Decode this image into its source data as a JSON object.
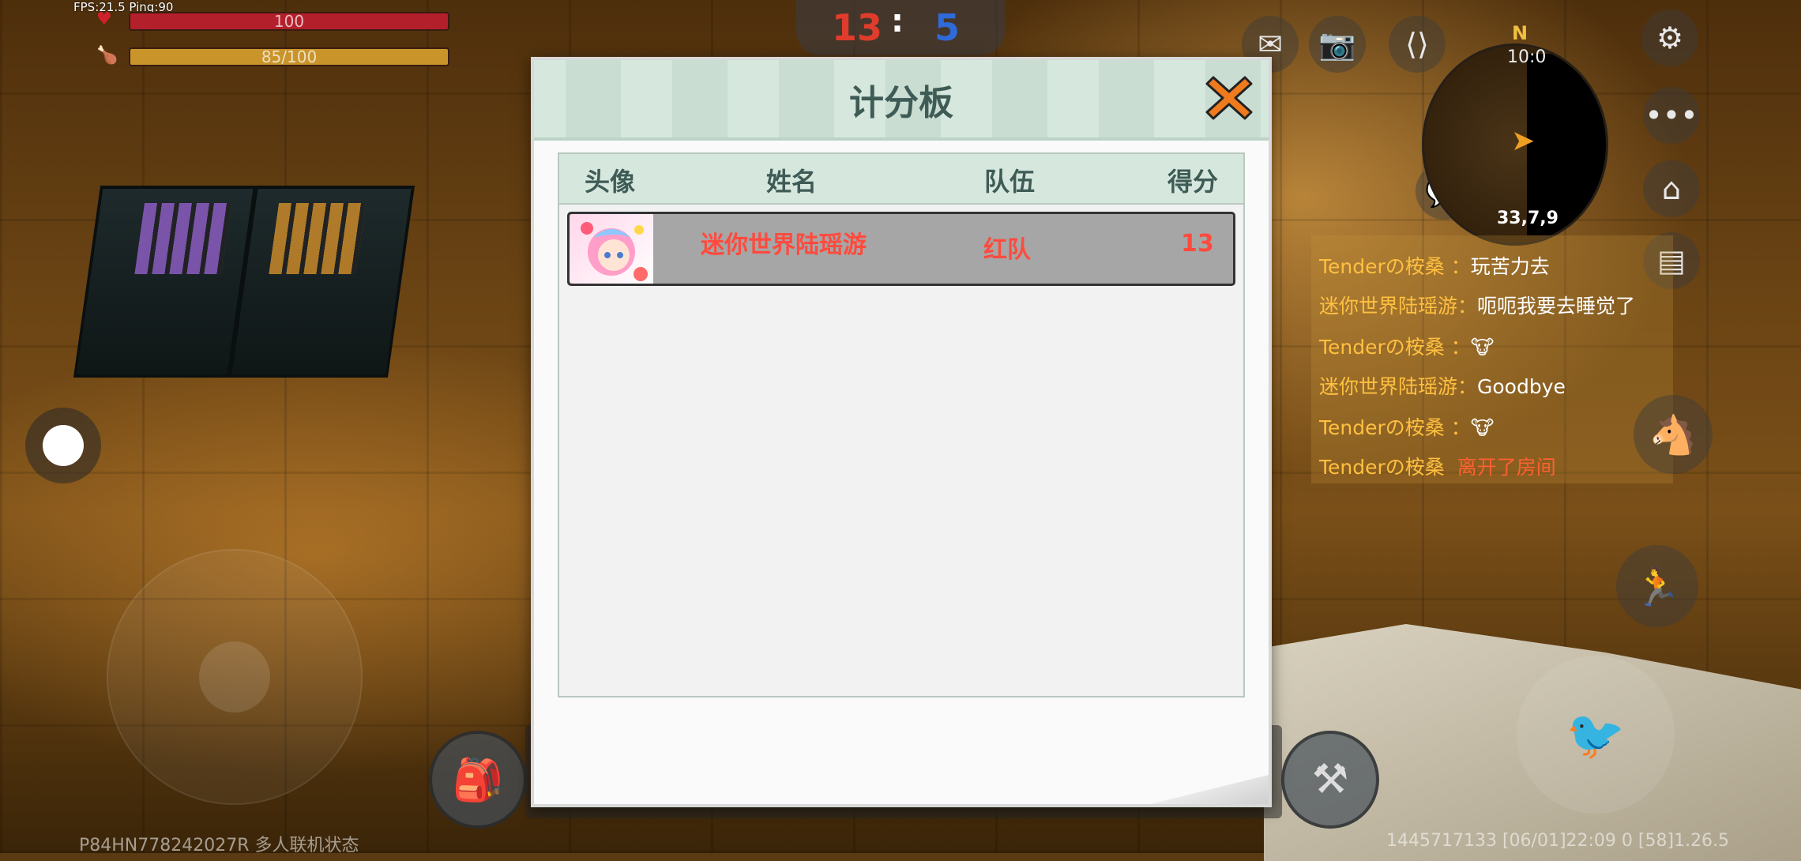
{
  "hud": {
    "fps_text": "FPS:21.5  Ping:90",
    "health": "100",
    "hunger": "85/100",
    "team_score_red": "13",
    "team_score_sep": ":",
    "team_score_blue": "5"
  },
  "minimap": {
    "north": "N",
    "time": "10:0",
    "coords": "33,7,9"
  },
  "chat": [
    {
      "who": "Tenderの桉桑    ：",
      "msg": "玩苦力去"
    },
    {
      "who": "迷你世界陆瑶游：",
      "msg": "呃呃我要去睡觉了"
    },
    {
      "who": "Tenderの桉桑    ：",
      "msg": ""
    },
    {
      "who": "迷你世界陆瑶游：",
      "msg": "Goodbye"
    },
    {
      "who": "Tenderの桉桑    ：",
      "msg": ""
    },
    {
      "who": "Tenderの桉桑",
      "msg": "离开了房间"
    }
  ],
  "footer": {
    "left": "P84HN778242027R 多人联机状态",
    "right": "1445717133   [06/01]22:09 0    [58]1.26.5"
  },
  "scoreboard": {
    "title": "计分板",
    "columns": [
      "头像",
      "姓名",
      "队伍",
      "得分"
    ],
    "rows": [
      {
        "name": "迷你世界陆瑶游",
        "team": "红队",
        "score": "13"
      }
    ]
  },
  "colors": {
    "red_team": "#e03c2c",
    "blue_team": "#2f6ad8",
    "row_text": "#ff4b3e",
    "header_bg": "#d6e8de"
  }
}
